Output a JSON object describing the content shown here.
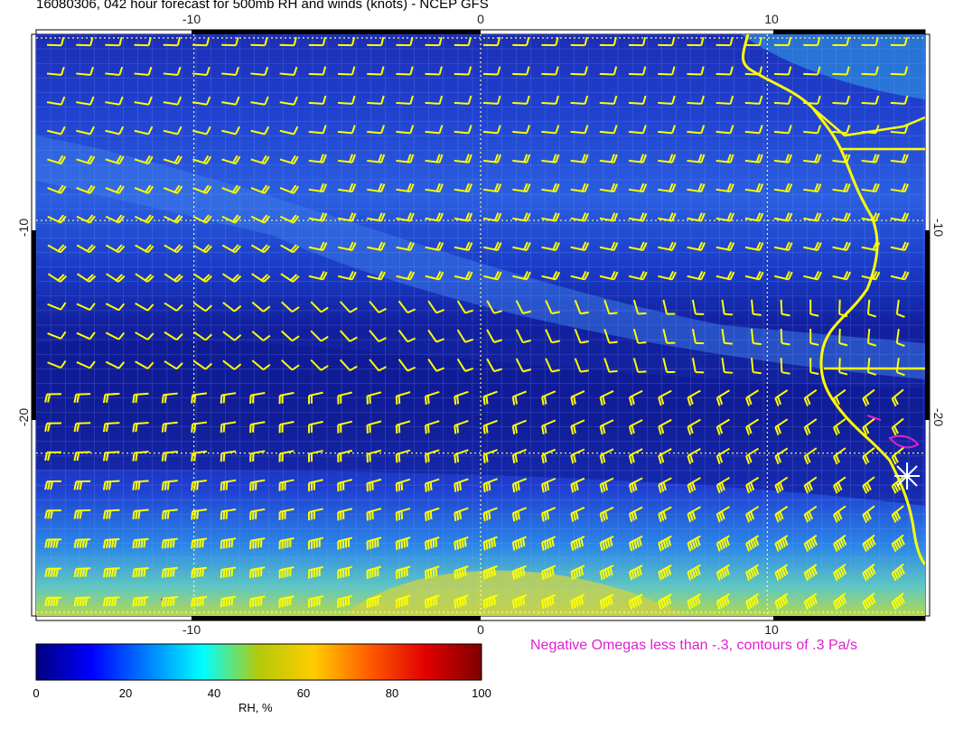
{
  "title": "16080306, 042 hour forecast for 500mb RH and winds (knots) - NCEP GFS",
  "axes": {
    "lon_ticks": [
      "-10",
      "0",
      "10"
    ],
    "lat_ticks": [
      "-10",
      "-20"
    ]
  },
  "colorbar": {
    "label": "RH, %",
    "ticks": [
      "0",
      "20",
      "40",
      "60",
      "80",
      "100"
    ],
    "range": [
      0,
      100
    ],
    "colormap": "jet"
  },
  "omega_note": "Negative Omegas less than -.3, contours of .3 Pa/s",
  "colors": {
    "wind_barbs": "#ffff00",
    "coastline": "#ffff00",
    "omega_contours": "#e020d0",
    "grid": "#ffff88"
  },
  "chart_data": {
    "type": "heatmap",
    "title": "16080306, 042 hour forecast for 500mb RH and winds (knots) - NCEP GFS",
    "variable": "RH, %",
    "vmin": 0,
    "vmax": 100,
    "lon_range": [
      -15.5,
      15.5
    ],
    "lat_range": [
      -27,
      -2
    ],
    "gridlines_lon": [
      -10,
      0,
      10
    ],
    "gridlines_lat": [
      -10,
      -20
    ],
    "rh_bands": [
      {
        "lat": -3,
        "value": 18
      },
      {
        "lat": -7,
        "value": 22
      },
      {
        "lat": -11,
        "value": 24
      },
      {
        "lat": -13.5,
        "value": 30
      },
      {
        "lat": -16,
        "value": 14
      },
      {
        "lat": -20,
        "value": 12
      },
      {
        "lat": -23,
        "value": 16
      },
      {
        "lat": -25,
        "value": 38
      },
      {
        "lat": -26.5,
        "value": 55
      }
    ],
    "station_marker": {
      "lon": 14.8,
      "lat": -22.6,
      "symbol": "star"
    }
  }
}
